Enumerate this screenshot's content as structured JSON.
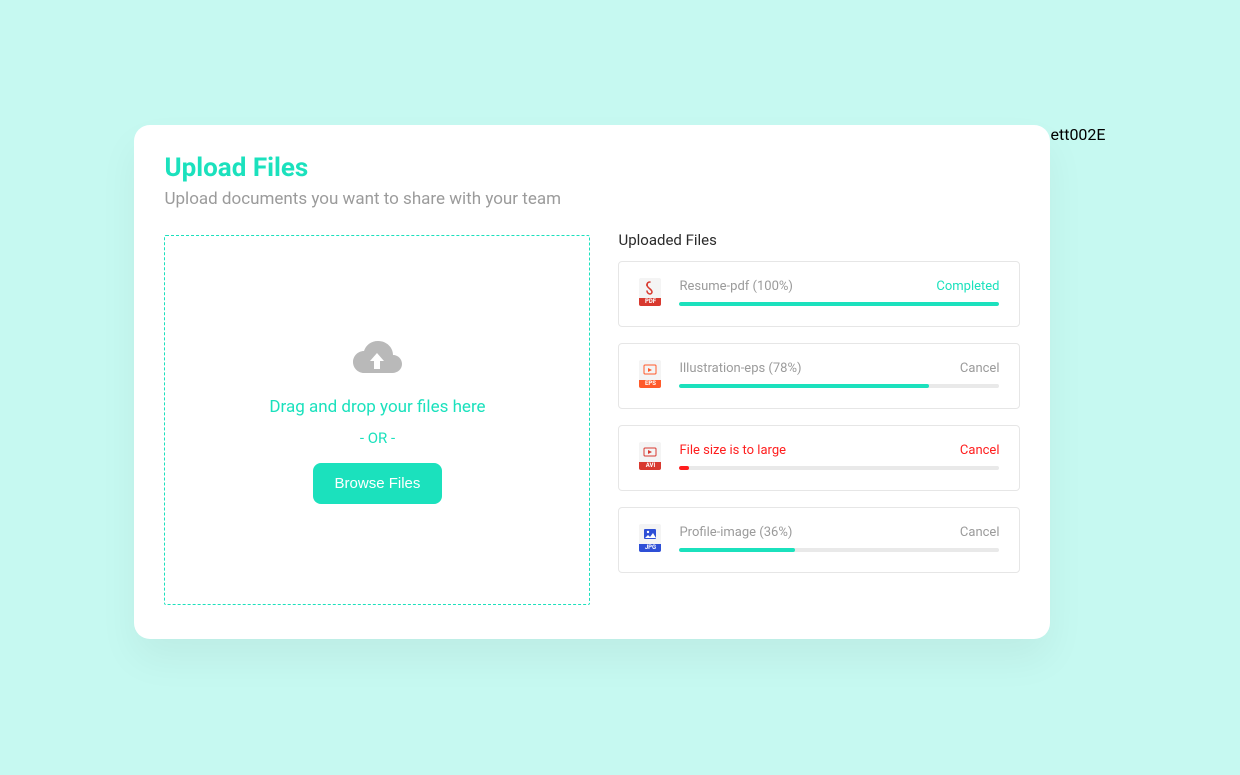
{
  "header": {
    "title": "Upload Files",
    "subtitle": "Upload documents you want to share with your team"
  },
  "dropzone": {
    "dnd_text": "Drag and drop your files here",
    "or_text": "- OR -",
    "browse_label": "Browse Files"
  },
  "uploaded": {
    "heading": "Uploaded Files",
    "files": [
      {
        "icon_type": "pdf",
        "name_display": "Resume-pdf (100%)",
        "progress": 100,
        "status_text": "Completed",
        "status_kind": "completed",
        "error": false
      },
      {
        "icon_type": "eps",
        "name_display": "Illustration-eps (78%)",
        "progress": 78,
        "status_text": "Cancel",
        "status_kind": "cancel",
        "error": false
      },
      {
        "icon_type": "avi",
        "name_display": "File size is to large",
        "progress": 3,
        "status_text": "Cancel",
        "status_kind": "error",
        "error": true
      },
      {
        "icon_type": "jpg",
        "name_display": "Profile-image (36%)",
        "progress": 36,
        "status_text": "Cancel",
        "status_kind": "cancel",
        "error": false
      }
    ]
  },
  "colors": {
    "accent": "#1be1bd",
    "error": "#ff1e1e",
    "muted": "#9b9b9b"
  }
}
